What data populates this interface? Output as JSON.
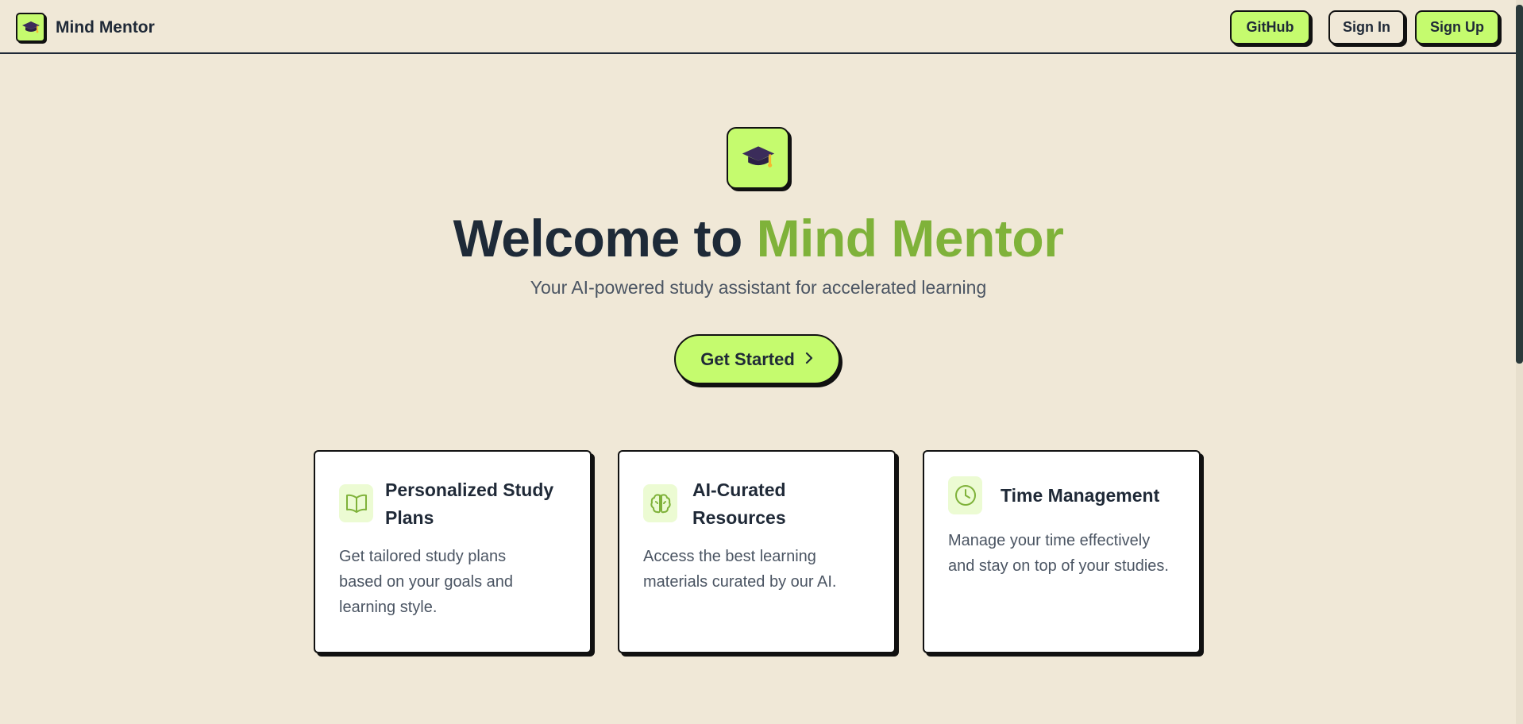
{
  "header": {
    "brand": "Mind Mentor",
    "github_label": "GitHub",
    "signin_label": "Sign In",
    "signup_label": "Sign Up"
  },
  "hero": {
    "title_prefix": "Welcome to ",
    "title_accent": "Mind Mentor",
    "subtitle": "Your AI-powered study assistant for accelerated learning",
    "cta_label": "Get Started"
  },
  "features": [
    {
      "title": "Personalized Study Plans",
      "description": "Get tailored study plans based on your goals and learning style.",
      "icon": "book-open-icon"
    },
    {
      "title": "AI-Curated Resources",
      "description": "Access the best learning materials curated by our AI.",
      "icon": "brain-icon"
    },
    {
      "title": "Time Management",
      "description": "Manage your time effectively and stay on top of your studies.",
      "icon": "clock-icon"
    }
  ],
  "colors": {
    "background": "#f0e8d7",
    "accent": "#c5fb6e",
    "accent_text": "#7fb23a",
    "dark": "#1e2a38"
  }
}
